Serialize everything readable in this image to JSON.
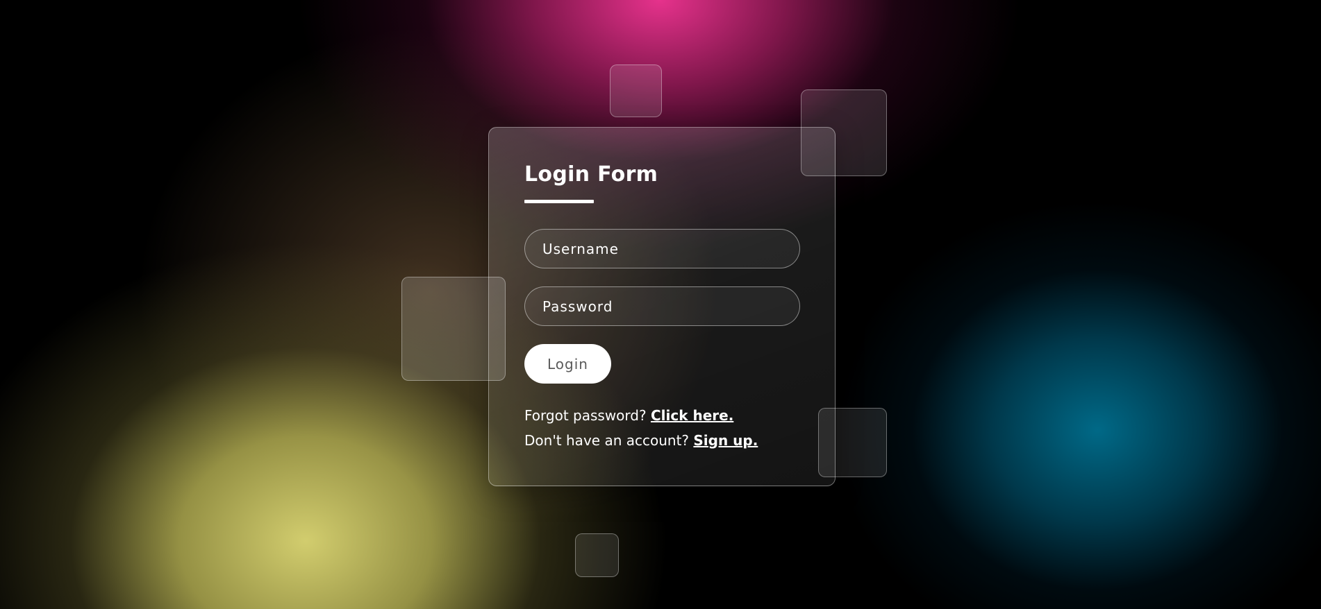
{
  "login_form": {
    "title": "Login Form",
    "username_placeholder": "Username",
    "password_placeholder": "Password",
    "login_button_label": "Login",
    "forgot_text": "Forgot password?",
    "forgot_link": "Click here.",
    "signup_text": "Don't have an account?",
    "signup_link": "Sign up."
  },
  "theme": {
    "accent_pink": "#e6328c",
    "accent_yellow": "#d2cd6e",
    "accent_teal": "#006987",
    "button_bg": "#ffffff",
    "button_text": "#5a5a5a",
    "text": "#ffffff"
  }
}
